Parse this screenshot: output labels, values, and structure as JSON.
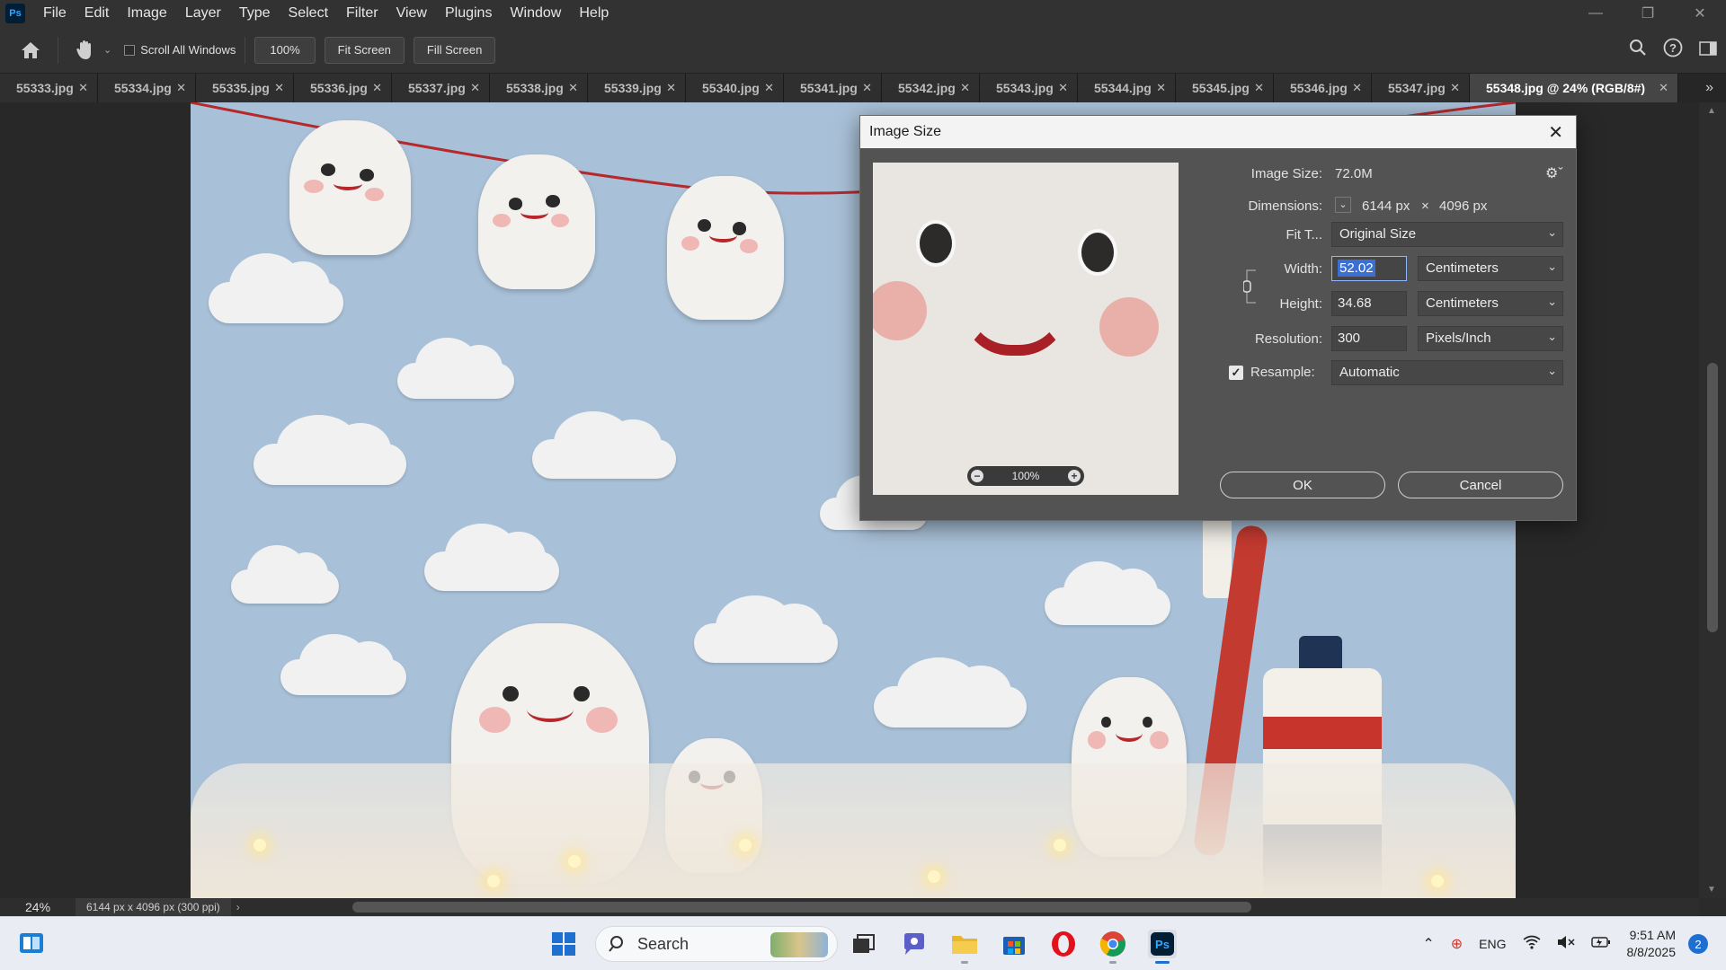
{
  "menubar": {
    "logo": "Ps",
    "items": [
      "File",
      "Edit",
      "Image",
      "Layer",
      "Type",
      "Select",
      "Filter",
      "View",
      "Plugins",
      "Window",
      "Help"
    ]
  },
  "options": {
    "scroll_all_windows": "Scroll All Windows",
    "zoom_value": "100%",
    "fit_screen": "Fit Screen",
    "fill_screen": "Fill Screen"
  },
  "tabs": [
    {
      "label": "55333.jpg"
    },
    {
      "label": "55334.jpg"
    },
    {
      "label": "55335.jpg"
    },
    {
      "label": "55336.jpg"
    },
    {
      "label": "55337.jpg"
    },
    {
      "label": "55338.jpg"
    },
    {
      "label": "55339.jpg"
    },
    {
      "label": "55340.jpg"
    },
    {
      "label": "55341.jpg"
    },
    {
      "label": "55342.jpg"
    },
    {
      "label": "55343.jpg"
    },
    {
      "label": "55344.jpg"
    },
    {
      "label": "55345.jpg"
    },
    {
      "label": "55346.jpg"
    },
    {
      "label": "55347.jpg"
    },
    {
      "label": "55348.jpg @ 24% (RGB/8#)",
      "active": true
    }
  ],
  "status": {
    "zoom": "24%",
    "doc_info": "6144 px x 4096 px (300 ppi)"
  },
  "dialog": {
    "title": "Image Size",
    "preview_zoom": "100%",
    "image_size_label": "Image Size:",
    "image_size_value": "72.0M",
    "dimensions_label": "Dimensions:",
    "dimensions_width": "6144 px",
    "dimensions_x": "×",
    "dimensions_height": "4096 px",
    "fit_to_label": "Fit T...",
    "fit_to_value": "Original Size",
    "width_label": "Width:",
    "width_value": "52.02",
    "width_unit": "Centimeters",
    "height_label": "Height:",
    "height_value": "34.68",
    "height_unit": "Centimeters",
    "resolution_label": "Resolution:",
    "resolution_value": "300",
    "resolution_unit": "Pixels/Inch",
    "resample_label": "Resample:",
    "resample_value": "Automatic",
    "ok": "OK",
    "cancel": "Cancel"
  },
  "taskbar": {
    "search_placeholder": "Search",
    "language": "ENG",
    "time": "9:51 AM",
    "date": "8/8/2025",
    "notifications": "2"
  },
  "colors": {
    "accent": "#1f6fd1",
    "ps_blue": "#31a8ff",
    "dialog_bg": "#535353"
  }
}
